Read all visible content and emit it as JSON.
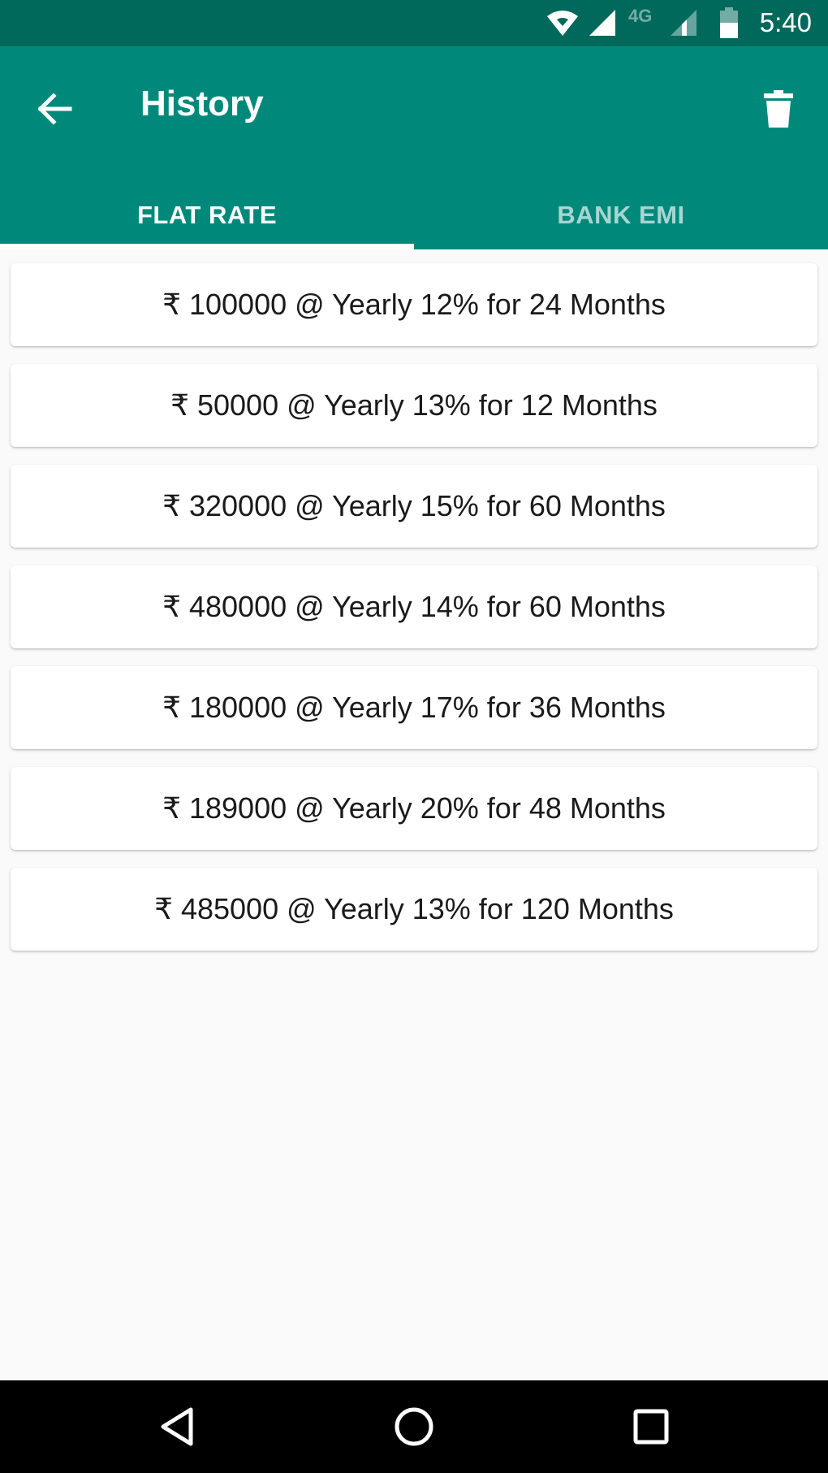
{
  "status_bar": {
    "time": "5:40",
    "network_label": "4G",
    "icons": [
      "wifi-icon",
      "signal-icon",
      "signal-weak-icon",
      "battery-icon"
    ]
  },
  "app_bar": {
    "title": "History",
    "back_icon": "arrow-left-icon",
    "delete_icon": "trash-icon",
    "color": "#00897b"
  },
  "tabs": [
    {
      "label": "FLAT RATE",
      "selected": true
    },
    {
      "label": "BANK EMI",
      "selected": false
    }
  ],
  "history_items": [
    {
      "label": "₹ 100000 @ Yearly 12% for 24 Months"
    },
    {
      "label": "₹ 50000 @ Yearly 13% for 12 Months"
    },
    {
      "label": "₹ 320000 @ Yearly 15% for 60 Months"
    },
    {
      "label": "₹ 480000 @ Yearly 14% for 60 Months"
    },
    {
      "label": "₹ 180000 @ Yearly 17% for 36 Months"
    },
    {
      "label": "₹ 189000 @ Yearly 20% for 48 Months"
    },
    {
      "label": "₹ 485000 @ Yearly 13% for 120 Months"
    }
  ],
  "nav_bar": {
    "icons": [
      "back-triangle-icon",
      "home-circle-icon",
      "recents-square-icon"
    ]
  },
  "colors": {
    "status_bar": "#00695c",
    "primary": "#00897b",
    "background": "#fafafa"
  }
}
